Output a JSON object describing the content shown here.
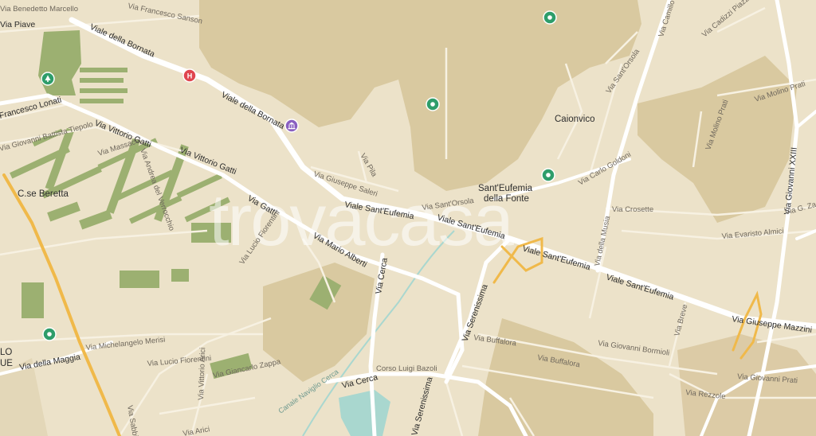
{
  "watermark": "trovacasa",
  "colors": {
    "land": "#ece2c9",
    "hill": "#d9c9a0",
    "park": "#9cb071",
    "road": "#ffffff",
    "highway": "#f0b94a",
    "water": "#a9d7cf",
    "poi_green": "#2e9d6a",
    "hospital": "#e0464f",
    "museum": "#8a5fc0"
  },
  "places": {
    "caionvico": "Caionvico",
    "santeufemia_1": "Sant'Eufemia",
    "santeufemia_2": "della Fonte",
    "beretta": "C.se Beretta",
    "lo": "LO",
    "ue": "UE"
  },
  "streets": {
    "benedetto_marcello": "Via Benedetto Marcello",
    "francesco_sanson": "Via Francesco Sanson",
    "piave": "Via Piave",
    "bornata_1": "Viale della Bornata",
    "bornata_2": "Viale della Bornata",
    "lonati": "Francesco Lonati",
    "tiepolo": "Via Giovanni Battista Tiepolo",
    "vittorio_gatti_1": "Via Vittorio Gatti",
    "vittorio_gatti_2": "Via Vittorio Gatti",
    "massacci": "Via Massacci",
    "verrocchio": "Via Andrea del Verrocchio",
    "saleri": "Via Giuseppe Saleri",
    "pila": "Via Pila",
    "santeufemia_1": "Viale Sant'Eufemia",
    "santeufemia_2": "Viale Sant'Eufemia",
    "santeufemia_3": "Viale Sant'Eufemia",
    "santeufemia_4": "Viale Sant'Eufemia",
    "santorsola_1": "Via Sant'Orsola",
    "santorsola_2": "Via Sant'Orsola",
    "carlo_goldoni": "Via Carlo Goldoni",
    "camillo": "Via Camillo",
    "cadizzi": "Via Cadizzi Piazza",
    "molino_prati_1": "Via Molino Prati",
    "molino_prati_2": "Via Molino Prati",
    "giovanni_xxiii": "Via Giovanni XXIII",
    "g_za": "Via G. Za",
    "crosette": "Via Crosette",
    "evaristo_almici": "Via Evaristo Almici",
    "della_musia": "Via della Musia",
    "gatti": "Via Gatti",
    "lucio_fiorentini_1": "Via Lucio Fiorentini",
    "lucio_fiorentini_2": "Via Lucio Fiorentini",
    "mario_alberti": "Via Mario Alberti",
    "cerca_1": "Via Cerca",
    "cerca_2": "Via Cerca",
    "serenissima_1": "Via Serenissima",
    "serenissima_2": "Via Serenissima",
    "michelangelo_merisi": "Via Michelangelo Merisi",
    "della_maggia": "Via della Maggia",
    "vittorio_arici": "Via Vittorio Arici",
    "giancarlo_zappa": "Via Giancarlo Zappa",
    "sabbion": "Via Sabbion",
    "arici": "Via Arici",
    "corso_bazoli": "Corso Luigi Bazoli",
    "buffalora_1": "Via Buffalora",
    "buffalora_2": "Via Buffalora",
    "bormioli": "Via Giovanni Bormioli",
    "breve": "Via Breve",
    "mazzini": "Via Giuseppe Mazzini",
    "giovanni_prati": "Via Giovanni Prati",
    "rezzole": "Via Rezzole"
  },
  "canal": "Canale Naviglio Cerca",
  "pois": [
    {
      "name": "poi-marker-hill-north",
      "icon": "location-pin-icon"
    },
    {
      "name": "poi-marker-hill-center",
      "icon": "location-pin-icon"
    },
    {
      "name": "poi-marker-santeufemia",
      "icon": "location-pin-icon"
    },
    {
      "name": "poi-marker-park-nw",
      "icon": "tree-icon"
    },
    {
      "name": "poi-marker-southwest",
      "icon": "location-pin-icon"
    },
    {
      "name": "hospital-marker",
      "icon": "hospital-icon",
      "label": "H"
    },
    {
      "name": "museum-marker",
      "icon": "museum-icon"
    }
  ]
}
